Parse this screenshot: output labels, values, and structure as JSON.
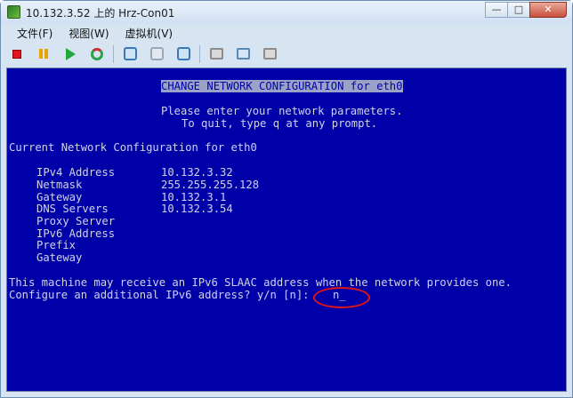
{
  "window": {
    "title": "10.132.3.52 上的 Hrz-Con01",
    "minimize_glyph": "—",
    "maximize_glyph": "□",
    "close_glyph": "✕"
  },
  "menu": {
    "items": [
      "文件(F)",
      "视图(W)",
      "虚拟机(V)"
    ]
  },
  "toolbar": {
    "buttons": [
      "stop-icon",
      "pause-icon",
      "play-icon",
      "reset-icon",
      "snapshot-icon",
      "snapshot-revert-icon",
      "snapshot-manager-icon",
      "console-settings-icon",
      "cd-icon",
      "usb-icon"
    ]
  },
  "console": {
    "header": "CHANGE NETWORK CONFIGURATION for eth0",
    "intro_line1": "Please enter your network parameters.",
    "intro_line2": "To quit, type q at any prompt.",
    "section_title": "Current Network Configuration for eth0",
    "fields": [
      {
        "label": "IPv4 Address",
        "value": "10.132.3.32"
      },
      {
        "label": "Netmask",
        "value": "255.255.255.128"
      },
      {
        "label": "Gateway",
        "value": "10.132.3.1"
      },
      {
        "label": "DNS Servers",
        "value": "10.132.3.54"
      },
      {
        "label": "Proxy Server",
        "value": ""
      },
      {
        "label": "IPv6 Address",
        "value": ""
      },
      {
        "label": "Prefix",
        "value": ""
      },
      {
        "label": "Gateway",
        "value": ""
      }
    ],
    "notice": "This machine may receive an IPv6 SLAAC address when the network provides one.",
    "prompt": "Configure an additional IPv6 address? y/n [n]:",
    "input": "n_"
  },
  "colors": {
    "console_bg": "#0000a8",
    "console_text": "#cfd3e6",
    "annotation": "#e01515"
  }
}
